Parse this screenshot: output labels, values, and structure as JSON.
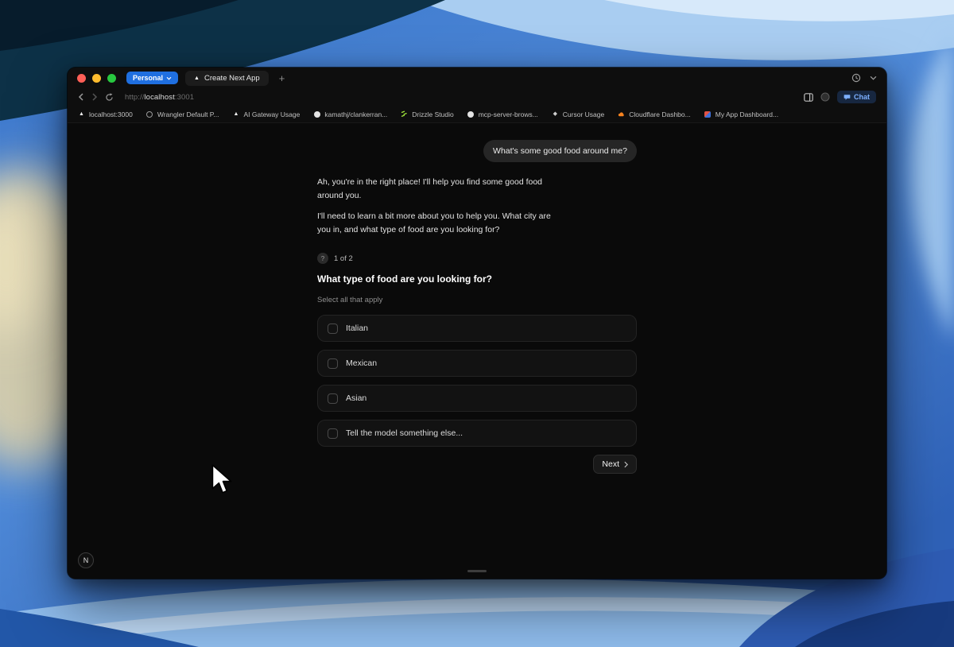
{
  "browser": {
    "profile_label": "Personal",
    "tab_title": "Create Next App",
    "new_tab_label": "+",
    "address": {
      "scheme": "http://",
      "host": "localhost",
      "port": ":3001"
    },
    "chat_button_label": "Chat",
    "bookmarks": [
      {
        "label": "localhost:3000",
        "icon": "vercel-triangle-icon"
      },
      {
        "label": "Wrangler Default P...",
        "icon": "globe-icon"
      },
      {
        "label": "AI Gateway Usage",
        "icon": "vercel-triangle-icon"
      },
      {
        "label": "kamathj/clankerran...",
        "icon": "github-icon"
      },
      {
        "label": "Drizzle Studio",
        "icon": "drizzle-icon"
      },
      {
        "label": "mcp-server-brows...",
        "icon": "github-icon"
      },
      {
        "label": "Cursor Usage",
        "icon": "cursor-icon"
      },
      {
        "label": "Cloudflare Dashbo...",
        "icon": "cloudflare-icon"
      },
      {
        "label": "My App Dashboard...",
        "icon": "app-favicon-icon"
      }
    ]
  },
  "chat": {
    "user_message": "What's some good food around me?",
    "assistant_paragraph_1": "Ah, you're in the right place! I'll help you find some good food around you.",
    "assistant_paragraph_2": "I'll need to learn a bit more about you to help you. What city are you in, and what type of food are you looking for?",
    "step_badge": "?",
    "step_indicator": "1 of 2",
    "question": "What type of food are you looking for?",
    "hint": "Select all that apply",
    "options": [
      {
        "label": "Italian",
        "checked": false
      },
      {
        "label": "Mexican",
        "checked": false
      },
      {
        "label": "Asian",
        "checked": false
      },
      {
        "label": "Tell the model something else...",
        "checked": false
      }
    ],
    "next_button_label": "Next",
    "avatar_letter": "N"
  },
  "colors": {
    "profile_badge": "#1f6fe0",
    "chat_accent": "#7db0ff",
    "page_background": "#0a0a0a",
    "user_bubble": "#262626"
  }
}
